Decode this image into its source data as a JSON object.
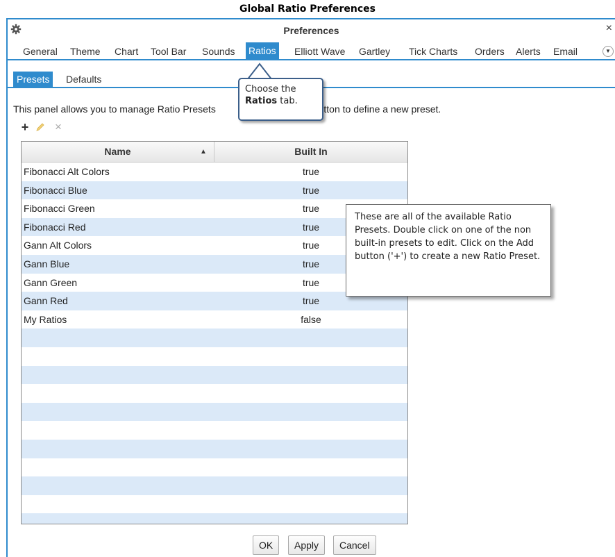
{
  "page_caption": "Global Ratio Preferences",
  "window": {
    "title": "Preferences",
    "close_label": "×",
    "gear_icon": "gear-icon",
    "accent_color": "#2f8bcd"
  },
  "tabs": [
    {
      "label": "General",
      "active": false
    },
    {
      "label": "Theme",
      "active": false
    },
    {
      "label": "Chart",
      "active": false
    },
    {
      "label": "Tool Bar",
      "active": false
    },
    {
      "label": "Sounds",
      "active": false
    },
    {
      "label": "Ratios",
      "active": true
    },
    {
      "label": "Elliott Wave",
      "active": false
    },
    {
      "label": "Gartley",
      "active": false
    },
    {
      "label": "Tick Charts",
      "active": false
    },
    {
      "label": "Orders",
      "active": false
    },
    {
      "label": "Alerts",
      "active": false
    },
    {
      "label": "Email",
      "active": false
    }
  ],
  "more_tabs_icon": "chevron-down-circle-icon",
  "subtabs": [
    {
      "label": "Presets",
      "active": true
    },
    {
      "label": "Defaults",
      "active": false
    }
  ],
  "description_before": "This panel allows you to manage Ratio Presets",
  "description_after": "button to define a new preset.",
  "toolbar": {
    "add_label": "+",
    "edit_icon": "pencil-icon",
    "delete_label": "×"
  },
  "table": {
    "columns": {
      "name": "Name",
      "built_in": "Built In"
    },
    "sort_indicator": "▲",
    "rows": [
      {
        "name": "Fibonacci Alt Colors",
        "built_in": "true"
      },
      {
        "name": "Fibonacci Blue",
        "built_in": "true"
      },
      {
        "name": "Fibonacci Green",
        "built_in": "true"
      },
      {
        "name": "Fibonacci Red",
        "built_in": "true"
      },
      {
        "name": "Gann Alt Colors",
        "built_in": "true"
      },
      {
        "name": "Gann Blue",
        "built_in": "true"
      },
      {
        "name": "Gann Green",
        "built_in": "true"
      },
      {
        "name": "Gann Red",
        "built_in": "true"
      },
      {
        "name": "My Ratios",
        "built_in": "false"
      }
    ],
    "stripe_color": "#dbe9f8"
  },
  "buttons": {
    "ok": "OK",
    "apply": "Apply",
    "cancel": "Cancel"
  },
  "callout_tab": {
    "line1": "Choose the",
    "bold": "Ratios",
    "rest": " tab."
  },
  "callout_note": "These are all of the available Ratio Presets.  Double click on one of the non built-in presets to edit.  Click on the Add button ('+') to create a new Ratio Preset."
}
